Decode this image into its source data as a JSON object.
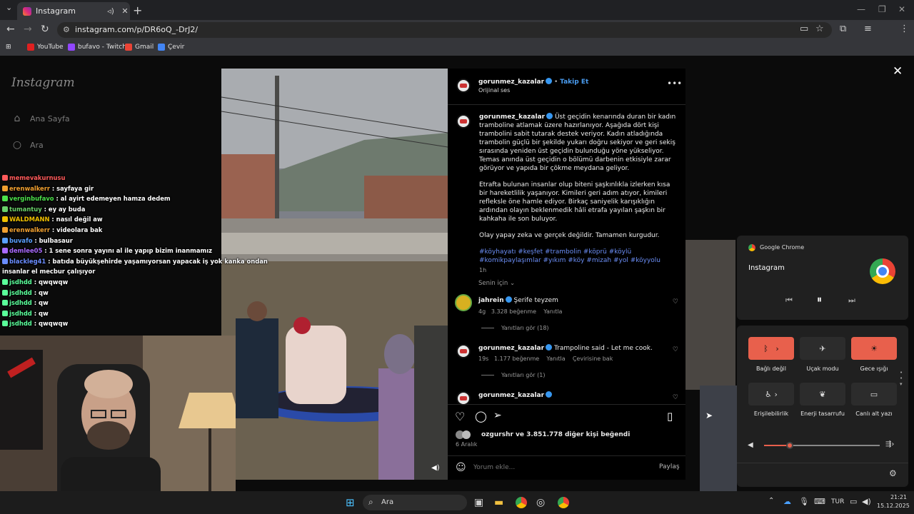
{
  "browser": {
    "tab_title": "Instagram",
    "tab_sound_icon": "speaker-icon",
    "tab_close": "✕",
    "new_tab": "+",
    "url": "instagram.com/p/DR6oQ_-DrJ2/",
    "bookmarks": [
      "YouTube",
      "bufavo - Twitch",
      "Gmail",
      "Çevir"
    ]
  },
  "instagram": {
    "logo": "Instagram",
    "nav": [
      "Ana Sayfa",
      "Ara"
    ],
    "post": {
      "username": "gorunmez_kazalar",
      "follow_label": "Takip Et",
      "audio": "Orijinal ses",
      "caption_p1": "Üst geçidin kenarında duran bir kadın tramboline atlamak üzere hazırlanıyor. Aşağıda dört kişi trambolini sabit tutarak destek veriyor. Kadın atladığında trambolin güçlü bir şekilde yukarı doğru sekiyor ve geri sekiş sırasında yeniden üst geçidin bulunduğu yöne yükseliyor. Temas anında üst geçidin o bölümü darbenin etkisiyle zarar görüyor ve yapıda bir çökme meydana geliyor.",
      "caption_p2": "Etrafta bulunan insanlar olup biteni şaşkınlıkla izlerken kısa bir hareketlilik yaşanıyor. Kimileri geri adım atıyor, kimileri refleksle öne hamle ediyor. Birkaç saniyelik karışıklığın ardından olayın beklenmedik hâli etrafa yayılan şaşkın bir kahkaha ile son buluyor.",
      "caption_p3": "Olay yapay zeka ve gerçek değildir. Tamamen kurgudur.",
      "hashtags": "#köyhayatı #keşfet #trambolin #köprü #köylü #komikpaylaşımlar #yıkım #köy #mizah #yol #köyyolu",
      "age": "1h",
      "translate_label": "Senin için",
      "comments": [
        {
          "user": "jahrein",
          "text": "Şerife teyzem",
          "age": "4g",
          "likes": "3.328 beğenme",
          "reply": "Yanıtla",
          "view_replies": "Yanıtları gör (18)"
        },
        {
          "user": "gorunmez_kazalar",
          "text": "Trampoline said - Let me cook.",
          "age": "19s",
          "likes": "1.177 beğenme",
          "reply": "Yanıtla",
          "translate": "Çevirisine bak",
          "view_replies": "Yanıtları gör (1)"
        },
        {
          "user": "gorunmez_kazalar"
        }
      ],
      "liked_by_user": "ozgurshr",
      "liked_by_rest": " ve 3.851.778 diğer kişi beğendi",
      "date": "6 Aralık",
      "comment_placeholder": "Yorum ekle...",
      "share_label": "Paylaş"
    }
  },
  "chat": [
    {
      "user": "memevakurnusu",
      "text": "",
      "color": "#ff5a5a"
    },
    {
      "user": "erenwalkerr",
      "text": ": sayfaya gir",
      "color": "#f0a030"
    },
    {
      "user": "verginbufavo",
      "text": ": al ayirt edemeyen hamza dedem",
      "color": "#4be04b"
    },
    {
      "user": "tumantuy",
      "text": ": ey ay buda",
      "color": "#6ad06a"
    },
    {
      "user": "WALDMANN",
      "text": ": nasıl değil aw",
      "color": "#f0c000"
    },
    {
      "user": "erenwalkerr",
      "text": ": videolara bak",
      "color": "#f0a030"
    },
    {
      "user": "buvafo",
      "text": ": bulbasaur",
      "color": "#5aa0ff"
    },
    {
      "user": "demlee05",
      "text": ": 1 sene sonra yayını al ile yapıp bizim inanmamız",
      "color": "#aa6aff"
    },
    {
      "user": "blackleg41",
      "text": ": batıda büyükşehirde yaşamıyorsan yapacak iş yok kanka ondan",
      "color": "#6a8cff"
    },
    {
      "user": "",
      "text": "insanlar el mecbur çalışıyor",
      "color": "#ffffff"
    },
    {
      "user": "jsdhdd",
      "text": ": qwqwqw",
      "color": "#5aff9a"
    },
    {
      "user": "jsdhdd",
      "text": ": qw",
      "color": "#5aff9a"
    },
    {
      "user": "jsdhdd",
      "text": ": qw",
      "color": "#5aff9a"
    },
    {
      "user": "jsdhdd",
      "text": ": qw",
      "color": "#5aff9a"
    },
    {
      "user": "jsdhdd",
      "text": ": qwqwqw",
      "color": "#5aff9a"
    }
  ],
  "media": {
    "app": "Google Chrome",
    "title": "Instagram"
  },
  "quick_settings": {
    "tiles": [
      "Bağlı değil",
      "Uçak modu",
      "Gece ışığı",
      "Erişilebilirlik",
      "Enerji tasarrufu",
      "Canlı alt yazı"
    ],
    "volume_percent": 22
  },
  "taskbar": {
    "search_placeholder": "Ara",
    "language": "TUR",
    "time": "21:21",
    "date": "15.12.2025"
  }
}
